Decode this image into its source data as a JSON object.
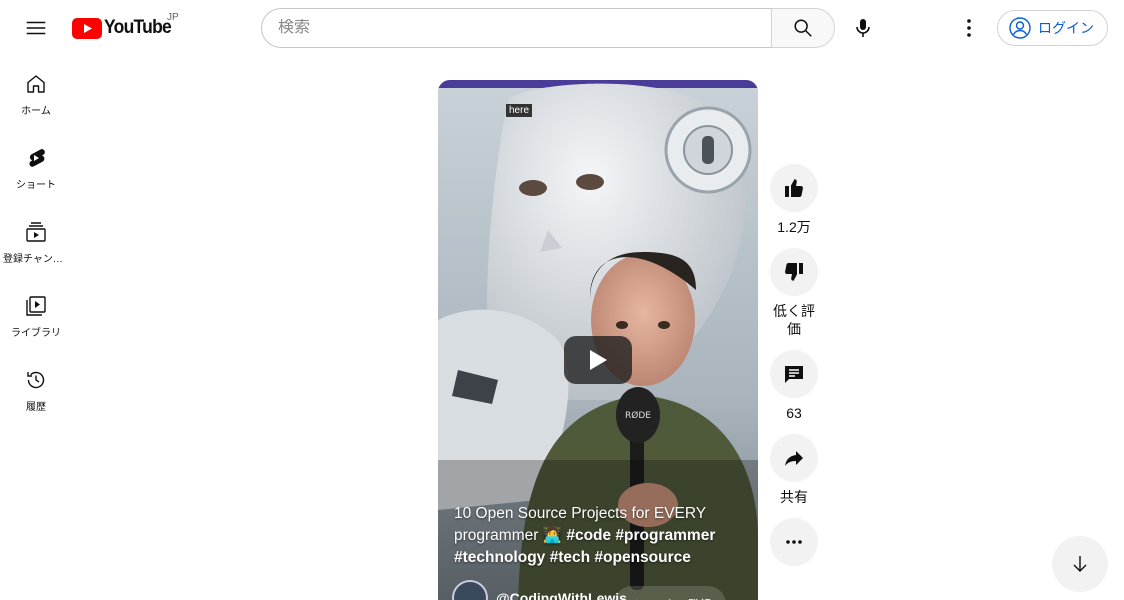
{
  "header": {
    "logo_text": "YouTube",
    "country_code": "JP",
    "search_placeholder": "検索",
    "login_label": "ログイン"
  },
  "guide": {
    "items": [
      {
        "label": "ホーム",
        "icon": "home-icon"
      },
      {
        "label": "ショート",
        "icon": "shorts-icon"
      },
      {
        "label": "登録チャンネル",
        "icon": "subscriptions-icon"
      },
      {
        "label": "ライブラリ",
        "icon": "library-icon"
      },
      {
        "label": "履歴",
        "icon": "history-icon"
      }
    ]
  },
  "short": {
    "overlay_tag": "here",
    "title_plain": "10 Open Source Projects for EVERY programmer 🧑‍💻 ",
    "title_tags": "#code #programmer #technology #tech #opensource",
    "channel_name": "@CodingWithLewis",
    "subscribe_label": "チャンネル登録"
  },
  "actions": {
    "like_count": "1.2万",
    "dislike_label": "低く評価",
    "comment_count": "63",
    "share_label": "共有"
  },
  "colors": {
    "brand_red": "#ff0000",
    "link_blue": "#065fd4"
  }
}
